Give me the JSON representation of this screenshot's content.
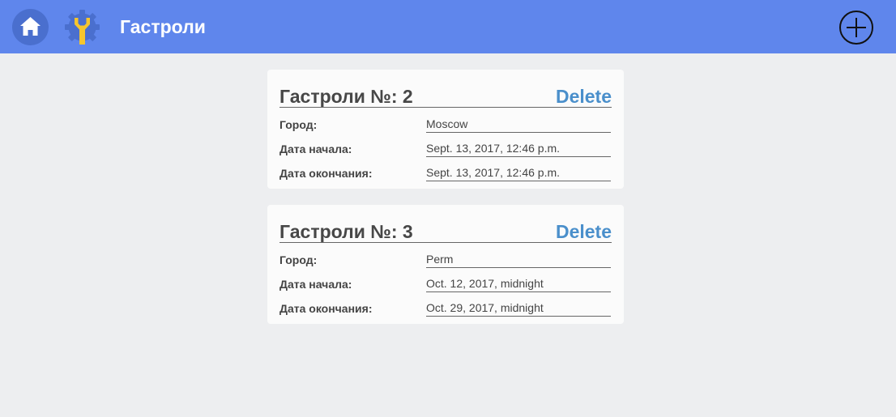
{
  "header": {
    "title": "Гастроли",
    "home_icon": "home-icon",
    "settings_icon": "settings-wrench-icon",
    "add_icon": "add-circle-icon",
    "background_color": "#5f86ec"
  },
  "tours": [
    {
      "title": "Гастроли №: 2",
      "delete_label": "Delete",
      "fields": [
        {
          "label": "Город:",
          "value": "Moscow"
        },
        {
          "label": "Дата начала:",
          "value": "Sept. 13, 2017, 12:46 p.m."
        },
        {
          "label": "Дата окончания:",
          "value": "Sept. 13, 2017, 12:46 p.m."
        }
      ]
    },
    {
      "title": "Гастроли №: 3",
      "delete_label": "Delete",
      "fields": [
        {
          "label": "Город:",
          "value": "Perm"
        },
        {
          "label": "Дата начала:",
          "value": "Oct. 12, 2017, midnight"
        },
        {
          "label": "Дата окончания:",
          "value": "Oct. 29, 2017, midnight"
        }
      ]
    }
  ],
  "colors": {
    "accent": "#4a8fcb",
    "page_background": "#edeef0",
    "card_background": "#fbfbfb"
  }
}
